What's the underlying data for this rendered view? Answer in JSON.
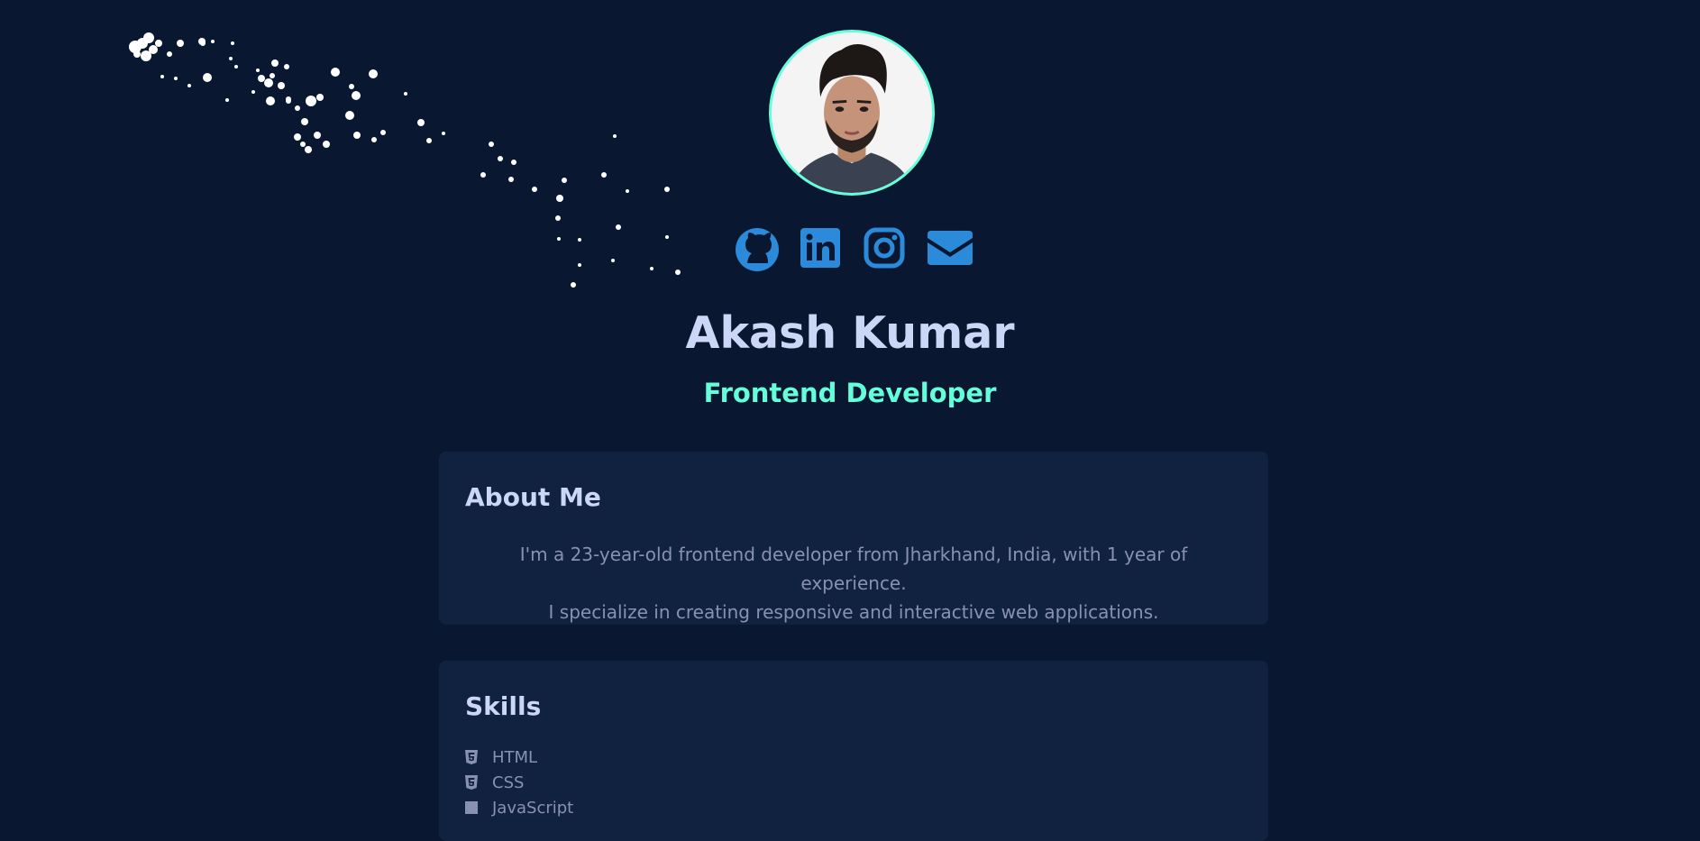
{
  "profile": {
    "name": "Akash Kumar",
    "role": "Frontend Developer",
    "avatar_icon": "profile-photo"
  },
  "socials": [
    {
      "name": "github",
      "icon": "github-icon"
    },
    {
      "name": "linkedin",
      "icon": "linkedin-icon"
    },
    {
      "name": "instagram",
      "icon": "instagram-icon"
    },
    {
      "name": "email",
      "icon": "envelope-icon"
    }
  ],
  "about": {
    "title": "About Me",
    "line1": "I'm a 23-year-old frontend developer from Jharkhand, India, with 1 year of experience.",
    "line2": "I specialize in creating responsive and interactive web applications."
  },
  "skills": {
    "title": "Skills",
    "items": [
      {
        "label": "HTML",
        "icon": "html5-icon"
      },
      {
        "label": "CSS",
        "icon": "css3-icon"
      },
      {
        "label": "JavaScript",
        "icon": "javascript-icon"
      }
    ]
  },
  "colors": {
    "background": "#0a1730",
    "card": "#112240",
    "accent": "#64ffda",
    "heading": "#ccd6f6",
    "text": "#8892b0",
    "icon_blue": "#2b8ad9"
  }
}
